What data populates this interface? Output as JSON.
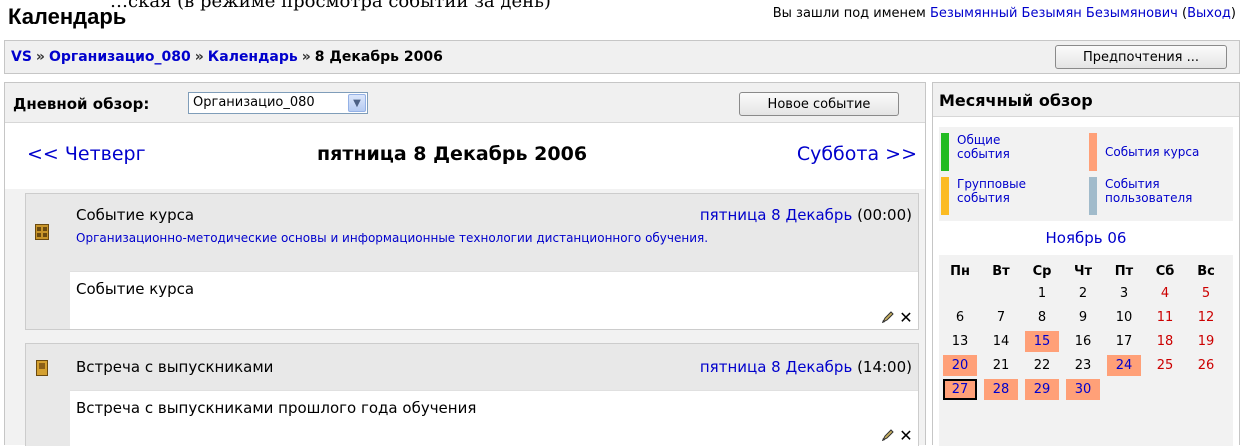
{
  "page_top_caption": "…ская (в режиме просмотра событий за день)",
  "site_title": "Календарь",
  "login": {
    "prefix": "Вы зашли под именем ",
    "user": "Безымянный Безымян Безымянович",
    "logout_open": " (",
    "logout": "Выход",
    "logout_close": ")"
  },
  "breadcrumb": {
    "items": [
      "VS",
      "Организацио_080",
      "Календарь",
      "8 Декабрь 2006"
    ],
    "separator": "»"
  },
  "preferences_button": "Предпочтения ...",
  "day_view": {
    "label": "Дневной обзор:",
    "course_select": "Организацио_080",
    "new_event_button": "Новое событие",
    "prev_day": "<< Четверг",
    "current_date": "пятница 8 Декабрь 2006",
    "next_day": "Суббота >>"
  },
  "events": [
    {
      "name": "Событие курса",
      "date_link": "пятница 8 Декабрь",
      "time": " (00:00)",
      "course": "Организационно-методические основы и информационные технологии дистанционного обучения.",
      "description": "Событие курса"
    },
    {
      "name": "Встреча с выпускниками",
      "date_link": "пятница 8 Декабрь",
      "time": " (14:00)",
      "description": "Встреча с выпускниками прошлого года обучения"
    }
  ],
  "month_view": {
    "title": "Месячный обзор",
    "legend": [
      {
        "label": "Общие события",
        "color": "#22bb22"
      },
      {
        "label": "События курса",
        "color": "#ffa078"
      },
      {
        "label": "Групповые события",
        "color": "#fbbb23"
      },
      {
        "label": "События пользователя",
        "color": "#a1bbcb"
      }
    ],
    "month_link": "Ноябрь 06",
    "weekdays": [
      "Пн",
      "Вт",
      "Ср",
      "Чт",
      "Пт",
      "Сб",
      "Вс"
    ],
    "weeks": [
      [
        "",
        "",
        "1",
        "2",
        "3",
        "4",
        "5"
      ],
      [
        "6",
        "7",
        "8",
        "9",
        "10",
        "11",
        "12"
      ],
      [
        "13",
        "14",
        "15",
        "16",
        "17",
        "18",
        "19"
      ],
      [
        "20",
        "21",
        "22",
        "23",
        "24",
        "25",
        "26"
      ],
      [
        "27",
        "28",
        "29",
        "30",
        "",
        "",
        ""
      ]
    ],
    "event_days": [
      "15",
      "20",
      "24",
      "27",
      "28",
      "29",
      "30"
    ],
    "highlighted_day": "27"
  },
  "colors": {
    "link": "#0000cc",
    "weekend": "#cc0000",
    "course_event": "#ffa078"
  }
}
